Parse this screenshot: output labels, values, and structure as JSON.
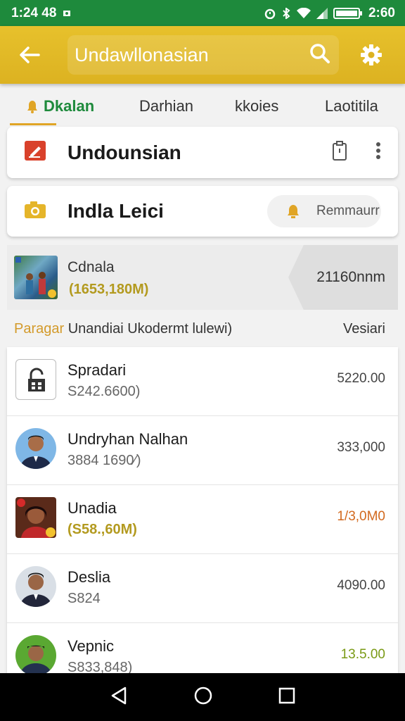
{
  "status_bar": {
    "left_text": "1:24 48",
    "right_text": "2:60"
  },
  "app_bar": {
    "search_text": "Undawllonasian"
  },
  "tabs": [
    {
      "label": "Dkalan",
      "active": true
    },
    {
      "label": "Darhian",
      "active": false
    },
    {
      "label": "kkoies",
      "active": false
    },
    {
      "label": "Laotitila",
      "active": false
    }
  ],
  "card1": {
    "title": "Undounsian"
  },
  "card2": {
    "title": "Indla Leici",
    "pill_label": "Remmaurr"
  },
  "featured": {
    "name": "Cdnala",
    "amount": "(1653,180M)",
    "chip_value": "21160nnm"
  },
  "list_header": {
    "prefix": "Paragar",
    "title": "Unandiai Ukodermt lulewi)",
    "right": "Vesiari"
  },
  "rows": [
    {
      "name": "Spradari",
      "sub": "S242.6600)",
      "value": "5220.00",
      "sub_style": "",
      "value_style": ""
    },
    {
      "name": "Undryhan Nalhan",
      "sub": "3884 1690⁄)",
      "value": "333,000",
      "sub_style": "",
      "value_style": ""
    },
    {
      "name": "Unadia",
      "sub": "(S58.,60M)",
      "value": "1/3,0M0",
      "sub_style": "gold",
      "value_style": "orange"
    },
    {
      "name": "Deslia",
      "sub": "S824",
      "value": "4090.00",
      "sub_style": "",
      "value_style": ""
    },
    {
      "name": "Vepnic",
      "sub": "S833,848)",
      "value": "13.5.00",
      "sub_style": "",
      "value_style": "green"
    }
  ],
  "colors": {
    "status_bar": "#1e8a3c",
    "app_bar": "#dcb221",
    "accent_gold": "#b39a1f",
    "orange": "#d2691e"
  }
}
